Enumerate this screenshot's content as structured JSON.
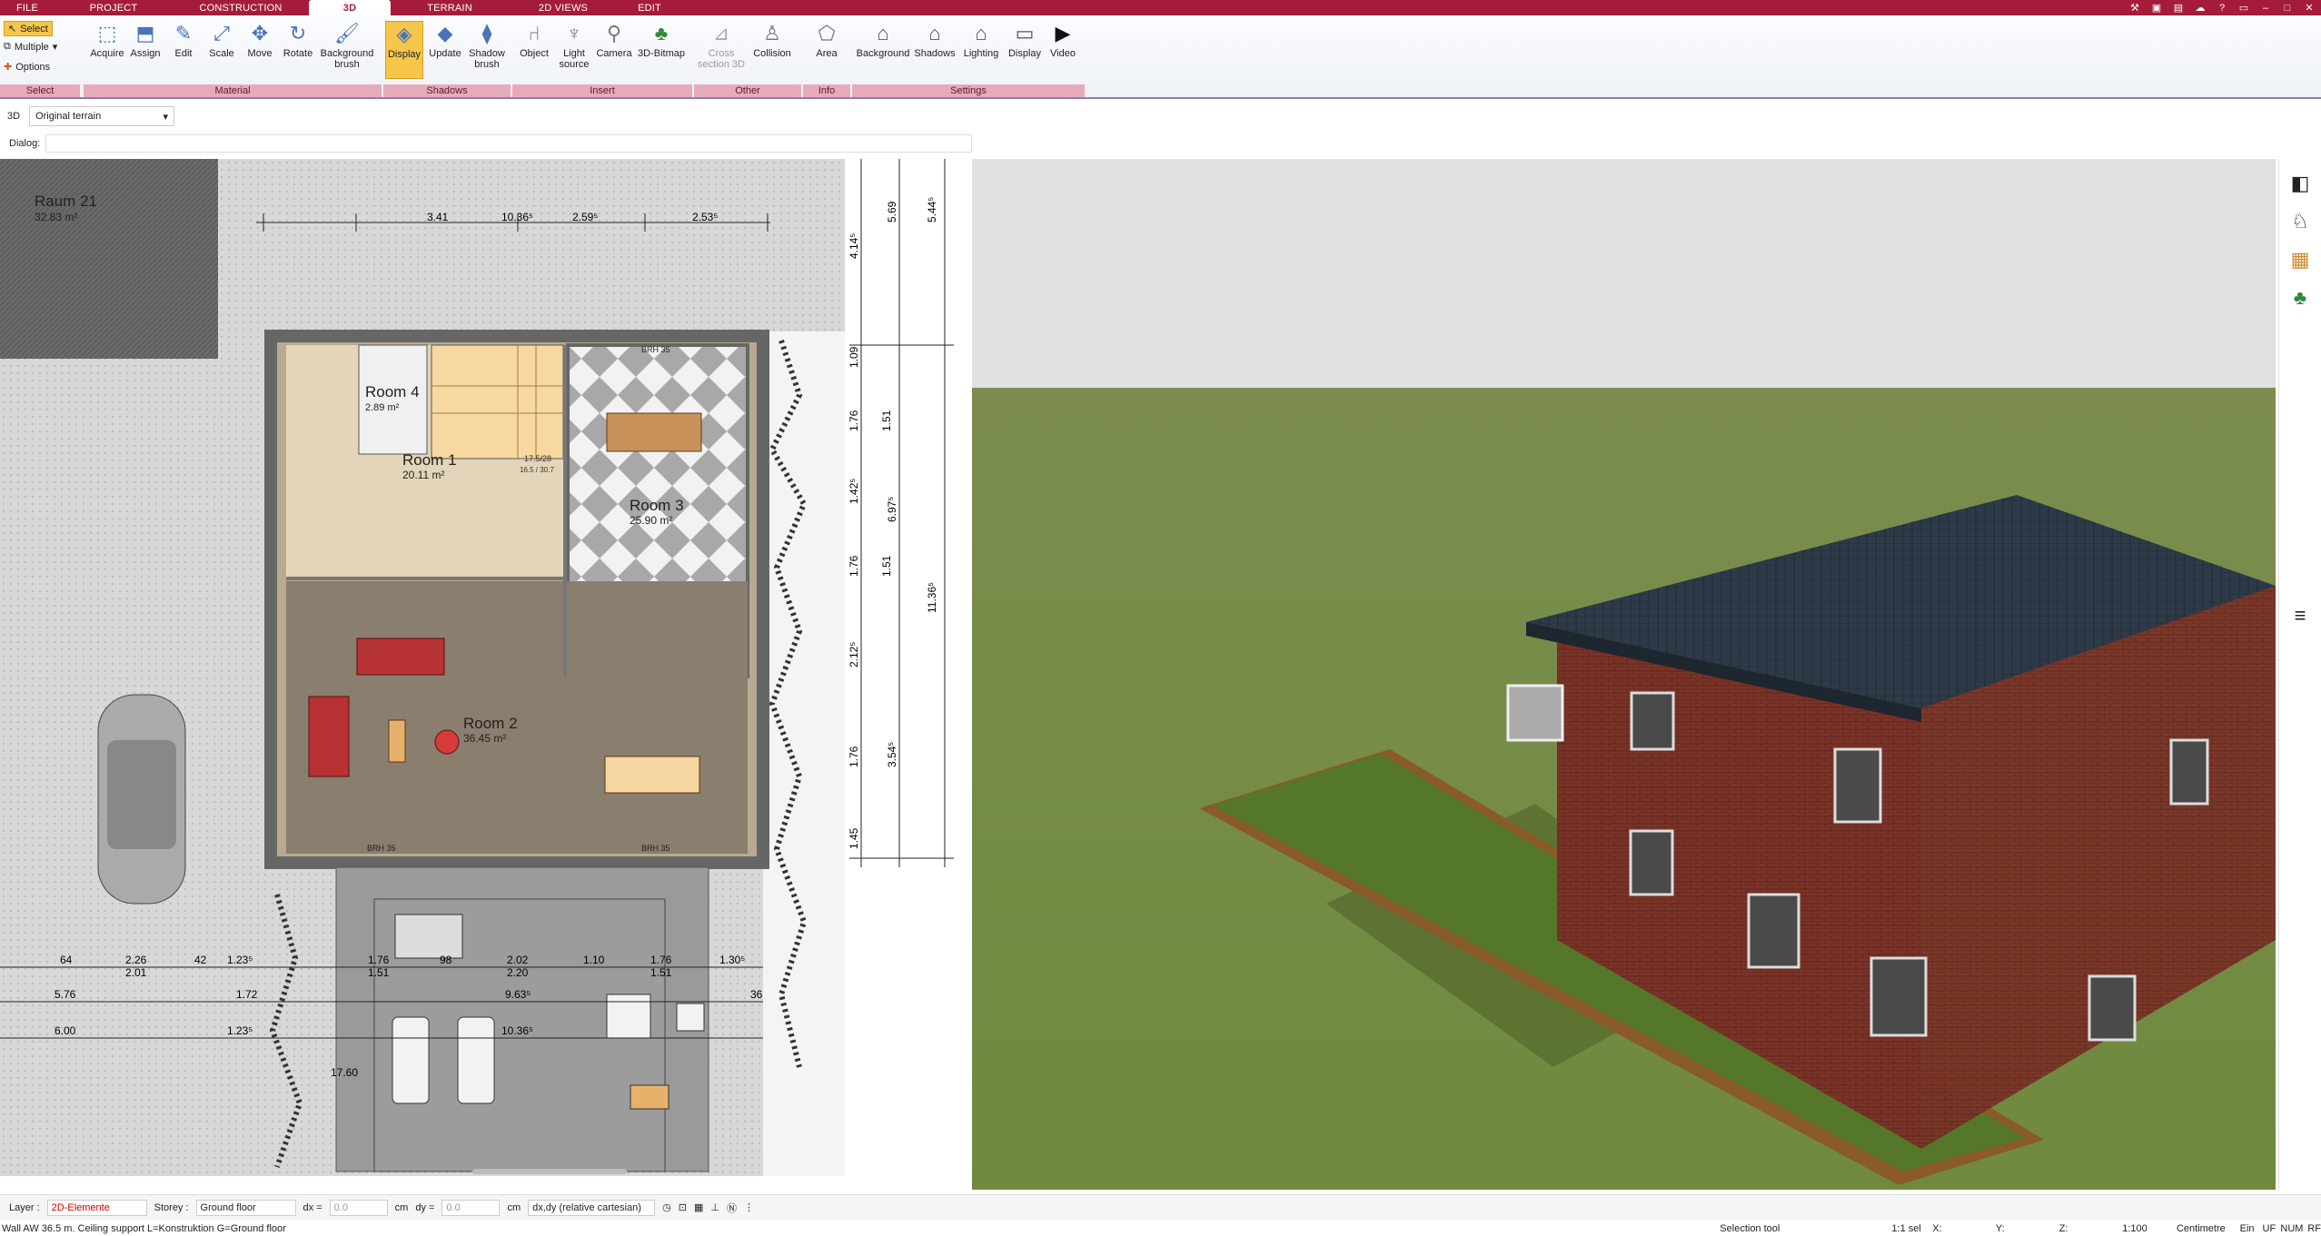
{
  "menu_tabs": [
    "FILE",
    "PROJECT",
    "CONSTRUCTION",
    "3D",
    "TERRAIN",
    "2D VIEWS",
    "EDIT"
  ],
  "active_tab": "3D",
  "select_group": {
    "select": "Select",
    "multiple": "Multiple",
    "options": "Options",
    "label": "Select"
  },
  "groups": {
    "material": "Material",
    "shadows": "Shadows",
    "insert": "Insert",
    "other": "Other",
    "info": "Info",
    "settings": "Settings"
  },
  "buttons": {
    "acquire": "Acquire",
    "assign": "Assign",
    "edit": "Edit",
    "scale": "Scale",
    "move": "Move",
    "rotate": "Rotate",
    "background_brush": "Background brush",
    "display": "Display",
    "update": "Update",
    "shadow_brush": "Shadow brush",
    "object": "Object",
    "light_source": "Light source",
    "camera": "Camera",
    "bitmap": "3D-Bitmap",
    "cross_section": "Cross section 3D",
    "collision": "Collision",
    "area": "Area",
    "background": "Background",
    "shadows_btn": "Shadows",
    "lighting": "Lighting",
    "display2": "Display",
    "video": "Video"
  },
  "toolbar2": {
    "mode": "3D",
    "terrain": "Original terrain"
  },
  "dialog_label": "Dialog:",
  "plan": {
    "rooms": [
      {
        "name": "Raum 21",
        "area": "32.83 m²"
      },
      {
        "name": "Room 4",
        "area": "2.89 m²"
      },
      {
        "name": "Room 1",
        "area": "20.11 m²"
      },
      {
        "name": "Room 3",
        "area": "25.90 m²"
      },
      {
        "name": "Room 2",
        "area": "36.45 m²"
      }
    ],
    "dims_top": [
      "3.41",
      "10.36⁵",
      "2.59⁵",
      "2.53⁵"
    ],
    "dims_right": [
      "1.09",
      "1.76",
      "1.51",
      "1.42⁵",
      "6.97⁵",
      "1.76",
      "1.51",
      "2.12⁵",
      "1.76",
      "3.54⁵",
      "1.45",
      "11.36⁵",
      "5.69",
      "5.44⁵",
      "4.14⁵"
    ],
    "dims_bottom": [
      "64",
      "2.26",
      "2.01",
      "42",
      "1.23⁵",
      "5.76",
      "1.72",
      "6.00",
      "1.23⁵",
      "1.76",
      "1.51",
      "98",
      "2.02",
      "2.20",
      "1.10",
      "1.76",
      "1.51",
      "1.30⁵",
      "9.63⁵",
      "10.36⁵",
      "36",
      "17.60"
    ],
    "brh": "BRH 35",
    "stair_label": "17.5/28",
    "stair_sub": "16.5 / 30.7"
  },
  "status": {
    "layer_label": "Layer :",
    "layer_value": "2D-Elemente",
    "storey_label": "Storey :",
    "storey_value": "Ground floor",
    "dx_label": "dx =",
    "dx_value": "0.0",
    "dy_label": "dy =",
    "dy_value": "0.0",
    "unit": "cm",
    "mode": "dx,dy (relative cartesian)"
  },
  "info": {
    "left": "Wall AW 36.5 m. Ceiling support L=Konstruktion G=Ground floor",
    "tool": "Selection tool",
    "scale_sel": "1:1 sel",
    "x": "X:",
    "y": "Y:",
    "z": "Z:",
    "scale": "1:100",
    "unit": "Centimetre",
    "ein": "Ein",
    "uf": "UF",
    "num": "NUM",
    "rf": "RF"
  }
}
